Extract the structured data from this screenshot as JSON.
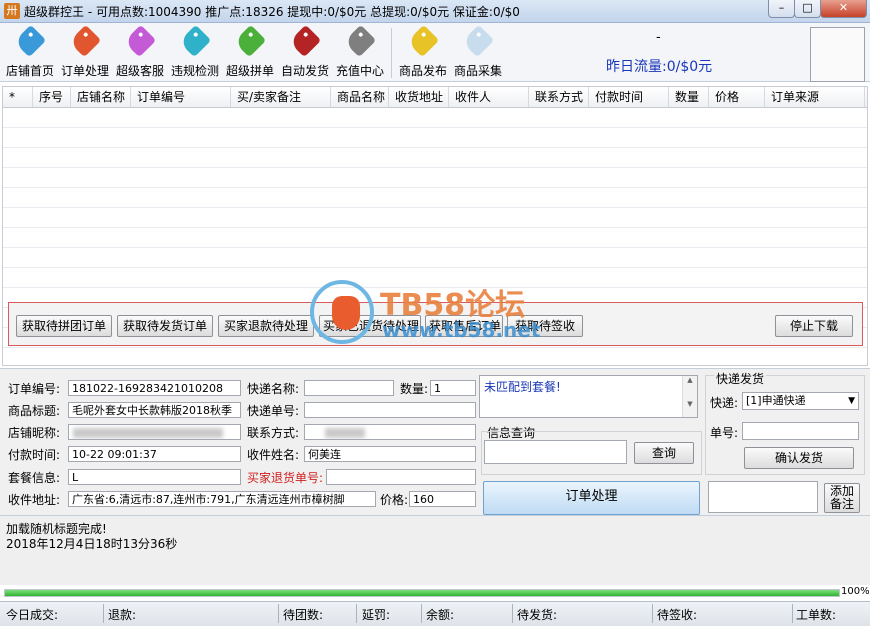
{
  "window": {
    "title": "超级群控王 - 可用点数:1004390 推广点:18326 提现中:0/$0元 总提现:0/$0元 保证金:0/$0",
    "min": "–",
    "max": "□",
    "close": "✕"
  },
  "toolbar": {
    "items": [
      {
        "label": "店铺首页",
        "color": "#3a9ad9",
        "icon": "shop-tag-icon"
      },
      {
        "label": "订单处理",
        "color": "#e2562f",
        "icon": "order-tag-icon"
      },
      {
        "label": "超级客服",
        "color": "#c45ad6",
        "icon": "service-tag-icon"
      },
      {
        "label": "违规检测",
        "color": "#2fb2c9",
        "icon": "violation-tag-icon"
      },
      {
        "label": "超级拼单",
        "color": "#4bb03a",
        "icon": "group-tag-icon"
      },
      {
        "label": "自动发货",
        "color": "#b52424",
        "icon": "delivery-tag-icon"
      },
      {
        "label": "充值中心",
        "color": "#7f7f7f",
        "icon": "recharge-tag-icon"
      },
      {
        "label": "商品发布",
        "color": "#e7c328",
        "icon": "publish-tag-icon"
      },
      {
        "label": "商品采集",
        "color": "#c7dced",
        "icon": "collect-tag-icon"
      }
    ],
    "dash": "-",
    "traffic": "昨日流量:0/$0元"
  },
  "grid": {
    "columns": [
      "*",
      "序号",
      "店铺名称",
      "订单编号",
      "买/卖家备注",
      "商品名称",
      "收货地址",
      "收件人",
      "联系方式",
      "付款时间",
      "数量",
      "价格",
      "订单来源"
    ]
  },
  "actions": {
    "buttons": [
      "获取待拼团订单",
      "获取待发货订单",
      "买家退款待处理",
      "买家已退货待处理",
      "获取售后订单",
      "获取待签收"
    ],
    "stop": "停止下载"
  },
  "watermark": {
    "text": "TB58论坛",
    "url": "www.tb58.net"
  },
  "detail": {
    "order_no_label": "订单编号:",
    "order_no": "181022-169283421010208",
    "title_label": "商品标题:",
    "title": "毛呢外套女中长款韩版2018秋季",
    "shop_label": "店铺昵称:",
    "pay_time_label": "付款时间:",
    "pay_time": "10-22 09:01:37",
    "package_label": "套餐信息:",
    "package": "L",
    "address_label": "收件地址:",
    "address": "广东省:6,清远市:87,连州市:791,广东清远连州市樟树脚",
    "express_name_label": "快递名称:",
    "express_no_label": "快递单号:",
    "contact_label": "联系方式:",
    "receiver_label": "收件姓名:",
    "receiver": "何美连",
    "return_label": "买家退货单号:",
    "qty_label": "数量:",
    "qty": "1",
    "price_label": "价格:",
    "price": "160",
    "match_text": "未匹配到套餐!",
    "query_title": "信息查询",
    "query_button": "查询",
    "process_button": "订单处理",
    "add_remark_button": "添加备注"
  },
  "shipping": {
    "title": "快递发货",
    "express_label": "快递:",
    "express_value": "[1]申通快递",
    "no_label": "单号:",
    "confirm_button": "确认发货"
  },
  "log": {
    "lines": [
      "加载随机标题完成!",
      "2018年12月4日18时13分36秒"
    ]
  },
  "progress": {
    "percent": 100,
    "label": "100%"
  },
  "status": {
    "today_deal": "今日成交:",
    "refund": "退款:",
    "pending_group": "待团数:",
    "penalty": "延罚:",
    "balance": "余额:",
    "pending_ship": "待发货:",
    "pending_sign": "待签收:",
    "ticket": "工单数:"
  }
}
